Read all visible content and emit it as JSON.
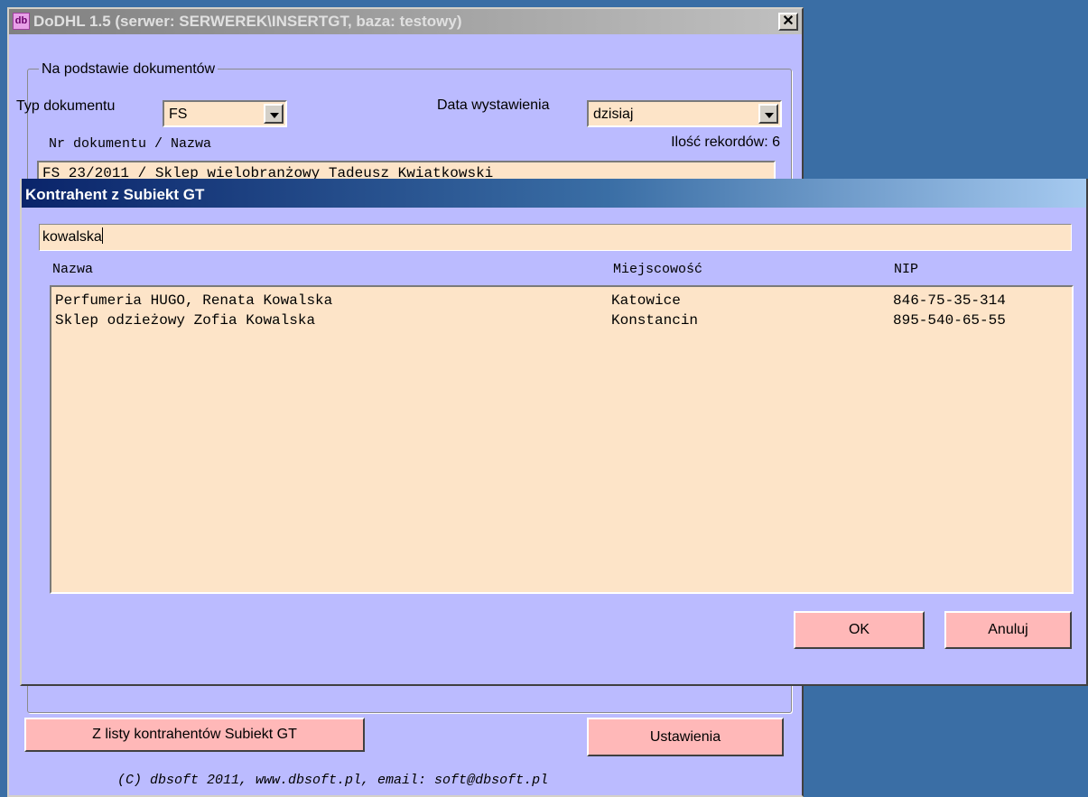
{
  "main_window": {
    "icon_text": "db",
    "title": "DoDHL 1.5 (serwer: SERWEREK\\INSERTGT, baza: testowy)",
    "close_glyph": "✕",
    "group_label": "Na podstawie dokumentów",
    "doc_type_label": "Typ dokumentu",
    "doc_type_value": "FS",
    "date_label": "Data wystawienia",
    "date_value": "dzisiaj",
    "doc_list_label": "Nr dokumentu / Nazwa",
    "record_count": "Ilość rekordów: 6",
    "doc_first_item": "FS 23/2011 / Sklep wielobranżowy Tadeusz Kwiatkowski",
    "btn_contractors": "Z listy kontrahentów Subiekt GT",
    "btn_settings": "Ustawienia",
    "footer": "(C) dbsoft 2011, www.dbsoft.pl, email: soft@dbsoft.pl"
  },
  "dialog": {
    "title": "Kontrahent z Subiekt GT",
    "search_value": "kowalska",
    "columns": {
      "name": "Nazwa",
      "city": "Miejscowość",
      "nip": "NIP"
    },
    "rows": [
      {
        "name": "Perfumeria HUGO, Renata Kowalska",
        "city": "Katowice",
        "nip": "846-75-35-314"
      },
      {
        "name": "Sklep odzieżowy Zofia Kowalska",
        "city": "Konstancin",
        "nip": "895-540-65-55"
      }
    ],
    "btn_ok": "OK",
    "btn_cancel": "Anuluj"
  },
  "colors": {
    "desktop": "#3a6ea5",
    "window_bg": "#bbbbff",
    "field_bg": "#fde4c8",
    "button_bg": "#ffb8b8"
  }
}
